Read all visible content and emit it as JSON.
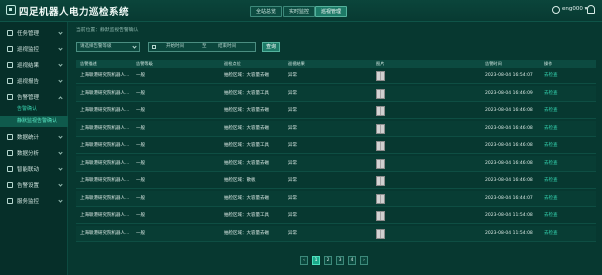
{
  "header": {
    "title": "四足机器人电力巡检系统",
    "nav": [
      "全站总览",
      "实时监控",
      "巡视管理"
    ],
    "user": "eng000 ▾"
  },
  "sidebar": {
    "items": [
      "任务管理",
      "巡视监控",
      "巡视结果",
      "巡视报告",
      "告警管理",
      "数据统计",
      "数据分析",
      "智能联动",
      "告警设置",
      "服务监控"
    ],
    "submenu": [
      "告警确认",
      "静默监视告警确认"
    ]
  },
  "breadcrumb": "当前位置：静默监视告警确认",
  "filters": {
    "select_placeholder": "请选择告警等级",
    "start_placeholder": "开始时间",
    "separator": "至",
    "end_placeholder": "结束时间",
    "search_label": "查询"
  },
  "table": {
    "headers": [
      "告警描述",
      "告警等级",
      "巡检点位",
      "巡视结果",
      "图片",
      "告警时间",
      "操作"
    ],
    "rows": [
      [
        "上海联港研究院机器人...",
        "一般",
        "抽检区域：大容量去磁",
        "异常",
        "2023-08-04 16:54:07",
        "去检查"
      ],
      [
        "上海联港研究院机器人...",
        "一般",
        "抽检区域：大容量工具",
        "异常",
        "2023-08-04 16:46:09",
        "去检查"
      ],
      [
        "上海联港研究院机器人...",
        "一般",
        "抽检区域：大容量去磁",
        "异常",
        "2023-08-04 16:46:08",
        "去检查"
      ],
      [
        "上海联港研究院机器人...",
        "一般",
        "抽检区域：大容量去磁",
        "异常",
        "2023-08-04 16:46:08",
        "去检查"
      ],
      [
        "上海联港研究院机器人...",
        "一般",
        "抽检区域：大容量工具",
        "异常",
        "2023-08-04 16:46:08",
        "去检查"
      ],
      [
        "上海联港研究院机器人...",
        "一般",
        "抽检区域：大容量去磁",
        "异常",
        "2023-08-04 16:46:08",
        "去检查"
      ],
      [
        "上海联港研究院机器人...",
        "一般",
        "抽检区域：散板",
        "异常",
        "2023-08-04 16:46:08",
        "去检查"
      ],
      [
        "上海联港研究院机器人...",
        "一般",
        "抽检区域：大容量去磁",
        "异常",
        "2023-08-04 16:44:07",
        "去检查"
      ],
      [
        "上海联港研究院机器人...",
        "一般",
        "抽检区域：大容量工具",
        "异常",
        "2023-08-04 11:54:08",
        "去检查"
      ],
      [
        "上海联港研究院机器人...",
        "一般",
        "抽检区域：大容量去磁",
        "异常",
        "2023-08-04 11:54:08",
        "去检查"
      ]
    ]
  },
  "pagination": {
    "prev": "‹",
    "pages": [
      "1",
      "2",
      "3",
      "4"
    ],
    "next": "›",
    "current": "1"
  },
  "colors": {
    "accent": "#1aa88a",
    "link": "#35d7b3",
    "background": "#07362f"
  },
  "icons": {
    "logo": "logo-icon",
    "user": "user-icon",
    "bell": "bell-icon",
    "menu": "menu-icon",
    "calendar": "calendar-icon",
    "dropdown": "chevron-down-icon"
  }
}
